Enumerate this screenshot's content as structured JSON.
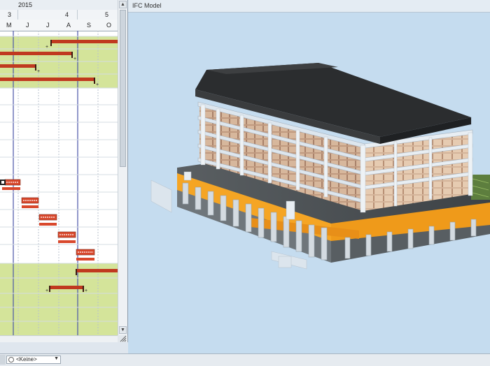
{
  "gantt": {
    "year": "2015",
    "quarters": [
      "3",
      "4",
      "5"
    ],
    "months": [
      "M",
      "J",
      "J",
      "A",
      "S",
      "O"
    ]
  },
  "model": {
    "title": "IFC Model"
  },
  "statusbar": {
    "combo_value": "<Keine>"
  }
}
